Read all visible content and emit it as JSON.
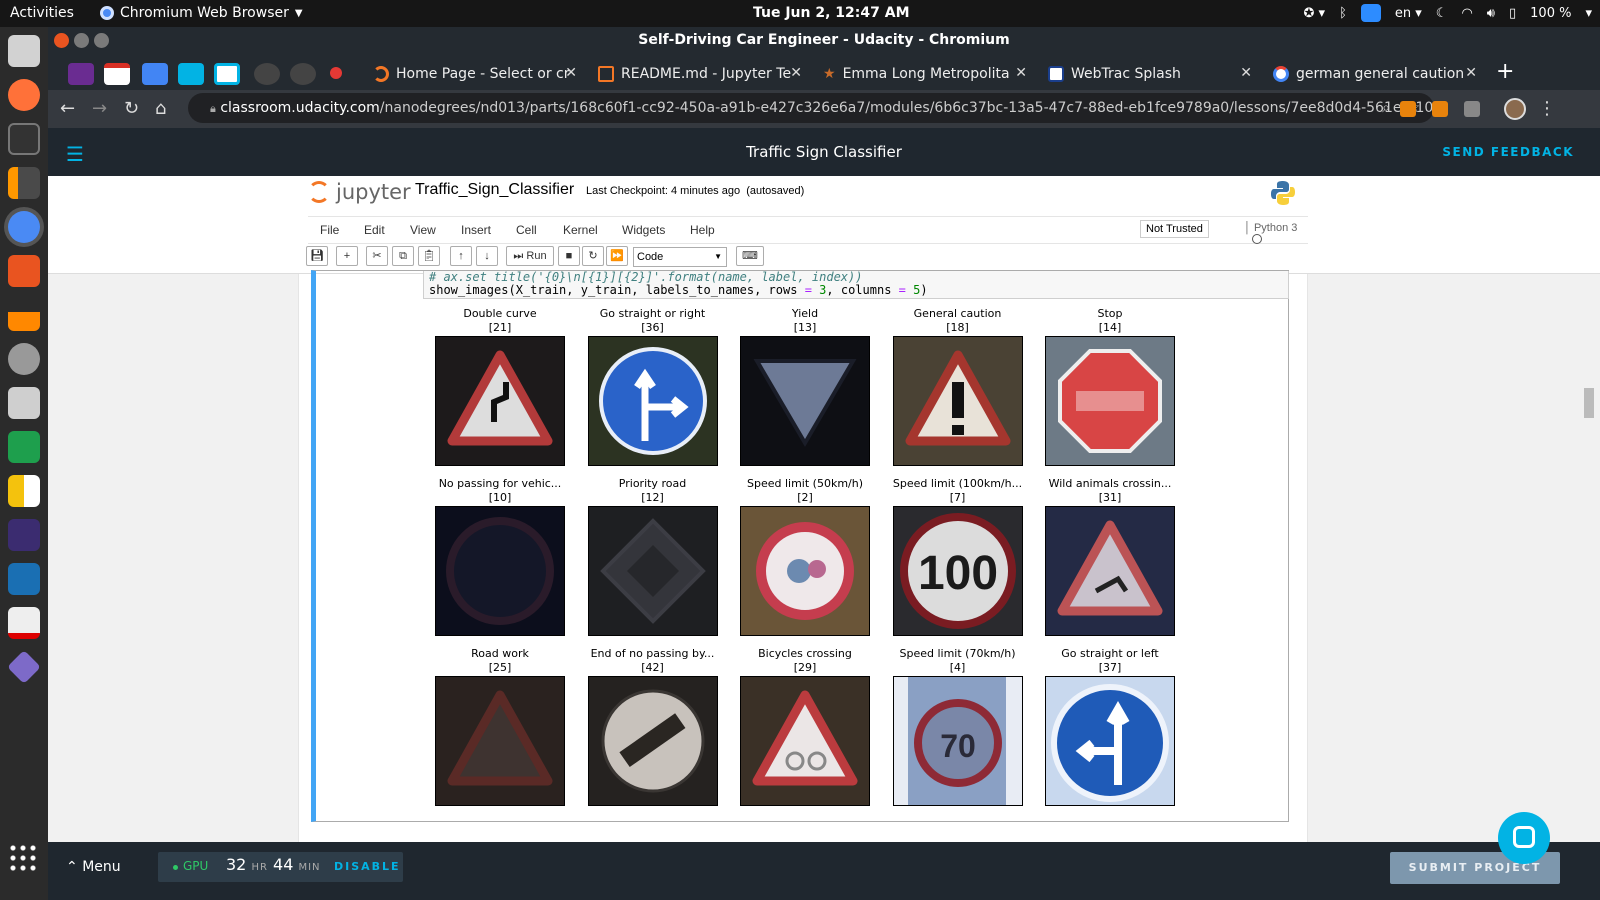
{
  "topbar": {
    "activities": "Activities",
    "app_name": "Chromium Web Browser",
    "clock": "Tue Jun  2, 12:47 AM",
    "lang": "en",
    "battery": "100 %"
  },
  "window": {
    "title": "Self-Driving Car Engineer - Udacity - Chromium"
  },
  "tabs": [
    {
      "title": "Home Page - Select or cr",
      "icon": "jupyter-icon"
    },
    {
      "title": "README.md - Jupyter Te",
      "icon": "file-icon"
    },
    {
      "title": "Emma Long Metropolita",
      "icon": "star-icon"
    },
    {
      "title": "WebTrac Splash",
      "icon": "webtrac-icon"
    },
    {
      "title": "german general caution",
      "icon": "google-icon"
    }
  ],
  "address": {
    "domain": "classroom.udacity.com",
    "path": "/nanodegrees/nd013/parts/168c60f1-cc92-450a-a91b-e427c326e6a7/modules/6b6c37bc-13a5-47c7-88ed-eb1fce9789a0/lessons/7ee8d0d4-561e-4101-..."
  },
  "udacity": {
    "header_title": "Traffic Sign Classifier",
    "feedback": "SEND FEEDBACK",
    "menu_label": "Menu",
    "gpu_label": "GPU",
    "hours": "32",
    "hours_unit": "HR",
    "minutes": "44",
    "minutes_unit": "MIN",
    "disable": "DISABLE",
    "submit": "SUBMIT PROJECT"
  },
  "jupyter": {
    "logo": "jupyter",
    "notebook_name": "Traffic_Sign_Classifier",
    "checkpoint": "Last Checkpoint: 4 minutes ago",
    "autosave": "(autosaved)",
    "menu": [
      "File",
      "Edit",
      "View",
      "Insert",
      "Cell",
      "Kernel",
      "Widgets",
      "Help"
    ],
    "not_trusted": "Not Trusted",
    "kernel": "Python 3",
    "run_label": "Run",
    "cell_type": "Code"
  },
  "code": {
    "comment_line": "#        ax.set_title('{0}\\n[{1}][{2}]'.format(name, label, index))",
    "call_a": "show_images(X_train, y_train, labels_to_names, rows ",
    "eq": "=",
    "three": "3",
    "call_b": ", columns ",
    "five": "5",
    "call_c": ")"
  },
  "signs": [
    {
      "name": "Double curve",
      "label": "[21]",
      "kind": "triangle",
      "bg": "#1d1a1b"
    },
    {
      "name": "Go straight or right",
      "label": "[36]",
      "kind": "blue-right",
      "bg": "#2c3322"
    },
    {
      "name": "Yield",
      "label": "[13]",
      "kind": "yield",
      "bg": "#0e0f14"
    },
    {
      "name": "General caution",
      "label": "[18]",
      "kind": "caution",
      "bg": "#4a4234"
    },
    {
      "name": "Stop",
      "label": "[14]",
      "kind": "stop",
      "bg": "#6d7a86"
    },
    {
      "name": "No passing for vehic...",
      "label": "[10]",
      "kind": "dark-circle",
      "bg": "#0c0e1c"
    },
    {
      "name": "Priority road",
      "label": "[12]",
      "kind": "diamond",
      "bg": "#1e1f22"
    },
    {
      "name": "Speed limit (50km/h)",
      "label": "[2]",
      "kind": "speed50",
      "bg": "#6a5538"
    },
    {
      "name": "Speed limit (100km/h...",
      "label": "[7]",
      "kind": "speed100",
      "bg": "#2a2a2e"
    },
    {
      "name": "Wild animals crossin...",
      "label": "[31]",
      "kind": "triangle-blue",
      "bg": "#242a45"
    },
    {
      "name": "Road work",
      "label": "[25]",
      "kind": "dark-triangle",
      "bg": "#2a221f"
    },
    {
      "name": "End of no passing by...",
      "label": "[42]",
      "kind": "end-np",
      "bg": "#252220"
    },
    {
      "name": "Bicycles crossing",
      "label": "[29]",
      "kind": "bike-tri",
      "bg": "#3a3026"
    },
    {
      "name": "Speed limit (70km/h)",
      "label": "[4]",
      "kind": "speed70",
      "bg": "#8aa0c4"
    },
    {
      "name": "Go straight or left",
      "label": "[37]",
      "kind": "blue-left",
      "bg": "#c8d8ee"
    }
  ]
}
